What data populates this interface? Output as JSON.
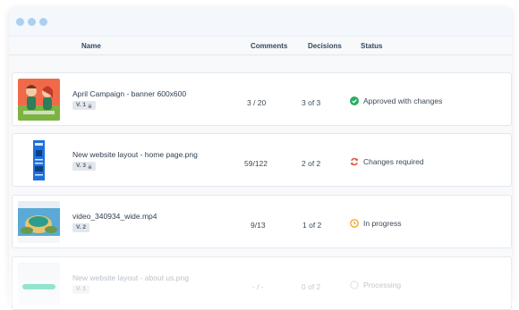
{
  "table": {
    "columns": {
      "name": "Name",
      "comments": "Comments",
      "decisions": "Decisions",
      "status": "Status"
    },
    "rows": [
      {
        "name": "April Campaign - banner 600x600",
        "version": "V. 1",
        "locked": true,
        "comments": "3 / 20",
        "decisions": "3 of 3",
        "status": "Approved with changes",
        "status_icon": "check-circle-icon",
        "status_color": "#27ae60"
      },
      {
        "name": "New website layout - home page.png",
        "version": "V. 3",
        "locked": true,
        "comments": "59/122",
        "decisions": "2 of 2",
        "status": "Changes required",
        "status_icon": "refresh-icon",
        "status_color": "#e55039"
      },
      {
        "name": "video_340934_wide.mp4",
        "version": "V. 2",
        "locked": false,
        "comments": "9/13",
        "decisions": "1 of 2",
        "status": "In progress",
        "status_icon": "clock-icon",
        "status_color": "#f39c12"
      },
      {
        "name": "New website layout - about us.png",
        "version": "V. 1",
        "locked": false,
        "comments": "- / -",
        "decisions": "0 of 2",
        "status": "Processing",
        "status_icon": "spinner-icon",
        "status_color": "#b0b8c0"
      }
    ]
  }
}
